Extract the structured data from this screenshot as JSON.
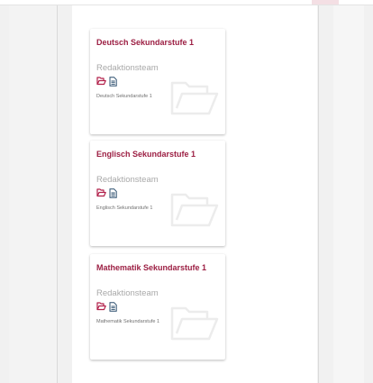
{
  "colors": {
    "title": "#9c1f43",
    "author": "#a9a9a9",
    "folder_icon": "#b2214b",
    "doc_icon": "#2c4f6e"
  },
  "icons": [
    "folder-icon",
    "document-icon",
    "folder-watermark-icon"
  ],
  "cards": [
    {
      "title": "Deutsch Sekundarstufe 1",
      "author": "Redaktionsteam",
      "description": "Deutsch Sekundarstufe 1"
    },
    {
      "title": "Englisch Sekundarstufe 1",
      "author": "Redaktionsteam",
      "description": "Englisch Sekundarstufe 1"
    },
    {
      "title": "Mathematik Sekundarstufe 1",
      "author": "Redaktionsteam",
      "description": "Mathematik Sekundarstufe 1"
    }
  ]
}
